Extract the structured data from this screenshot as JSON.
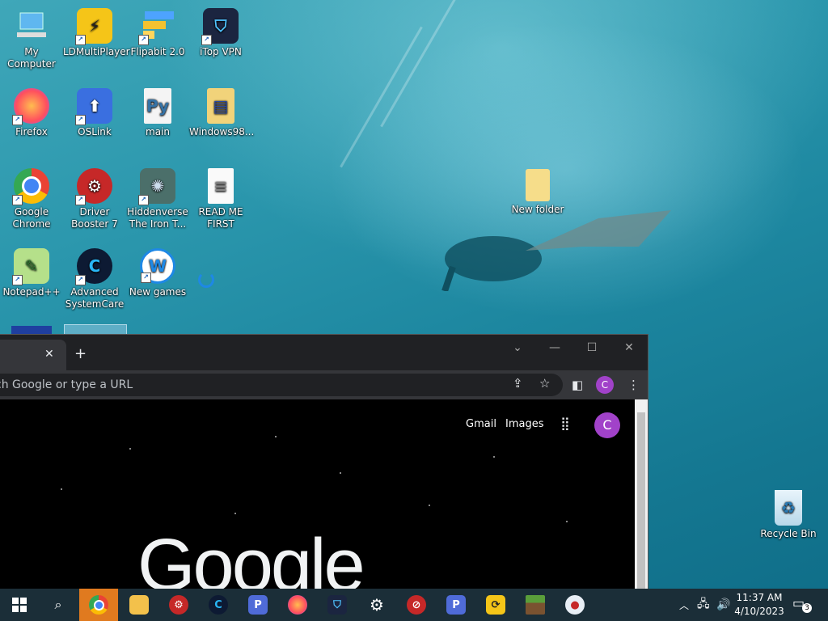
{
  "desktop": {
    "icons": [
      {
        "label": "My Computer",
        "icon": "computer-icon"
      },
      {
        "label": "LDMultiPlayer",
        "icon": "ldmultiplayer-icon"
      },
      {
        "label": "Flipabit 2.0",
        "icon": "flipabit-icon"
      },
      {
        "label": "iTop VPN",
        "icon": "itop-vpn-icon"
      },
      {
        "label": "Firefox",
        "icon": "firefox-icon"
      },
      {
        "label": "OSLink",
        "icon": "oslink-icon"
      },
      {
        "label": "main",
        "icon": "python-file-icon"
      },
      {
        "label": "Windows98...",
        "icon": "folder-icon"
      },
      {
        "label": "Google Chrome",
        "icon": "chrome-icon"
      },
      {
        "label": "Driver Booster 7",
        "icon": "driver-booster-icon"
      },
      {
        "label": "Hiddenverse The Iron T...",
        "icon": "hiddenverse-icon"
      },
      {
        "label": "READ ME FIRST",
        "icon": "text-file-icon"
      },
      {
        "label": "Notepad++",
        "icon": "notepadpp-icon"
      },
      {
        "label": "Advanced SystemCare",
        "icon": "advanced-systemcare-icon"
      },
      {
        "label": "New games",
        "icon": "new-games-icon"
      }
    ],
    "new_folder_label": "New folder",
    "recycle_bin_label": "Recycle Bin"
  },
  "browser": {
    "omnibox_text": "ch Google or type a URL",
    "profile_initial": "C",
    "links": {
      "gmail": "Gmail",
      "images": "Images"
    },
    "logo_text": "Google"
  },
  "taskbar": {
    "items": [
      "start-icon",
      "search-icon",
      "chrome-icon",
      "file-explorer-icon",
      "driver-booster-icon",
      "advanced-systemcare-icon",
      "p-app-icon",
      "firefox-icon",
      "itop-vpn-icon",
      "settings-icon",
      "no-ads-icon",
      "p-app-2-icon",
      "ld-player-icon",
      "minecraft-icon",
      "game-icon"
    ],
    "time": "11:37 AM",
    "date": "4/10/2023",
    "notification_count": "3"
  }
}
